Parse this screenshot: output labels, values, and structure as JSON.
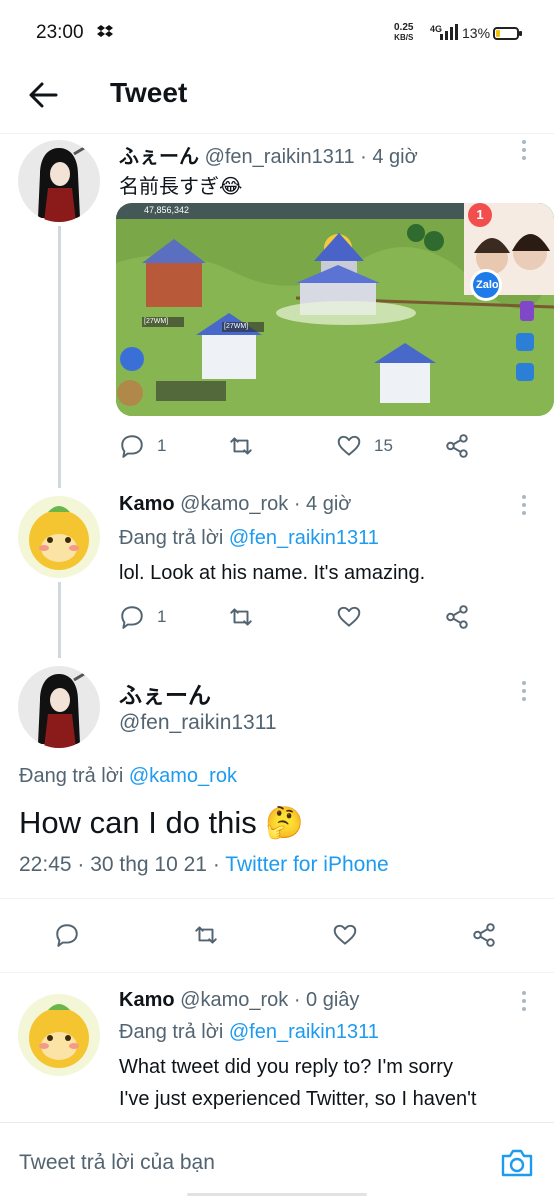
{
  "status_bar": {
    "time": "23:00",
    "net_speed_value": "0.25",
    "net_speed_unit": "KB/S",
    "network": "4G",
    "battery": "13%"
  },
  "header": {
    "title": "Tweet"
  },
  "tweets": [
    {
      "name": "ふぇーん",
      "handle": "@fen_raikin1311",
      "time": "· 4 giờ",
      "text": "名前長すぎ😂",
      "media": {
        "counter": "47,856,342",
        "badge": "1",
        "zalo_label": "Zalo",
        "banner_labels": [
          "[27WM]",
          "[27WM]"
        ]
      },
      "replies": "1",
      "likes": "15"
    },
    {
      "name": "Kamo",
      "handle": "@kamo_rok",
      "time": "· 4 giờ",
      "reply_prefix": "Đang trả lời",
      "reply_handle": "@fen_raikin1311",
      "text": "lol. Look at his name. It's amazing.",
      "replies": "1"
    }
  ],
  "focus": {
    "name": "ふぇーん",
    "handle": "@fen_raikin1311",
    "reply_prefix": "Đang trả lời",
    "reply_handle": "@kamo_rok",
    "text": "How can I do this 🤔",
    "timestamp": "22:45 · 30 thg 10 21 ·",
    "source": "Twitter for iPhone"
  },
  "reply": {
    "name": "Kamo",
    "handle": "@kamo_rok",
    "time": "· 0 giây",
    "reply_prefix": "Đang trả lời",
    "reply_handle": "@fen_raikin1311",
    "line1": "What tweet did you reply to? I'm sorry",
    "line2": "I've just experienced Twitter, so I haven't"
  },
  "compose": {
    "placeholder": "Tweet trả lời của bạn"
  },
  "colors": {
    "accent": "#1d9bf0",
    "secondary_text": "#536471",
    "primary_text": "#0f1419"
  }
}
